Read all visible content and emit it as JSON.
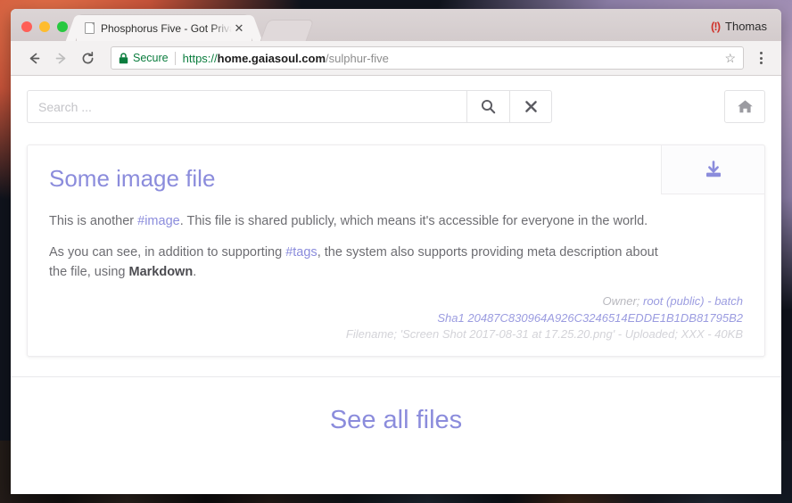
{
  "window": {
    "traffic_lights": [
      "close",
      "minimize",
      "maximize"
    ],
    "tab": {
      "title": "Phosphorus Five - Got Privacy?",
      "favicon": "page-icon",
      "close_label": "✕"
    },
    "profile": {
      "icon": "sync-error-icon",
      "icon_glyph": "(!)",
      "name": "Thomas"
    }
  },
  "toolbar": {
    "back_label": "←",
    "forward_label": "→",
    "reload_label": "↻",
    "security": {
      "lock_icon": "lock-icon",
      "label": "Secure"
    },
    "url": {
      "scheme": "https://",
      "host": "home.gaiasoul.com",
      "path": "/sulphur-five",
      "full": "https://home.gaiasoul.com/sulphur-five"
    },
    "bookmark_label": "☆",
    "menu_label": "menu"
  },
  "page": {
    "search": {
      "placeholder": "Search ...",
      "value": "",
      "search_button_icon": "magnifier-icon",
      "clear_button_icon": "close-x-icon",
      "clear_button_label": "✖"
    },
    "home_button_icon": "home-icon",
    "card": {
      "title": "Some image file",
      "download_button_icon": "download-icon",
      "paragraphs": [
        {
          "segments": [
            {
              "type": "text",
              "text": "This is another "
            },
            {
              "type": "link",
              "text": "#image"
            },
            {
              "type": "text",
              "text": ". This file is shared publicly, which means it's accessible for everyone in the world."
            }
          ]
        },
        {
          "segments": [
            {
              "type": "text",
              "text": "As you can see, in addition to supporting "
            },
            {
              "type": "link",
              "text": "#tags"
            },
            {
              "type": "text",
              "text": ", the system also supports providing meta description about the file, using "
            },
            {
              "type": "strong",
              "text": "Markdown"
            },
            {
              "type": "text",
              "text": "."
            }
          ]
        }
      ],
      "meta": {
        "owner_label": "Owner; ",
        "owner_value": "root (public) - batch",
        "sha1_label": "Sha1 ",
        "sha1_value": "20487C830964A926C3246514EDDE1B1DB81795B2",
        "file_line": "Filename; 'Screen Shot 2017-08-31 at 17.25.20.png' - Uploaded; XXX - 40KB"
      }
    },
    "see_all_files": "See all files"
  },
  "colors": {
    "accent_purple": "#8b8cdc",
    "secure_green": "#0b7d3e",
    "body_text": "#6d6d72",
    "meta_dim": "#b9b9bf"
  }
}
